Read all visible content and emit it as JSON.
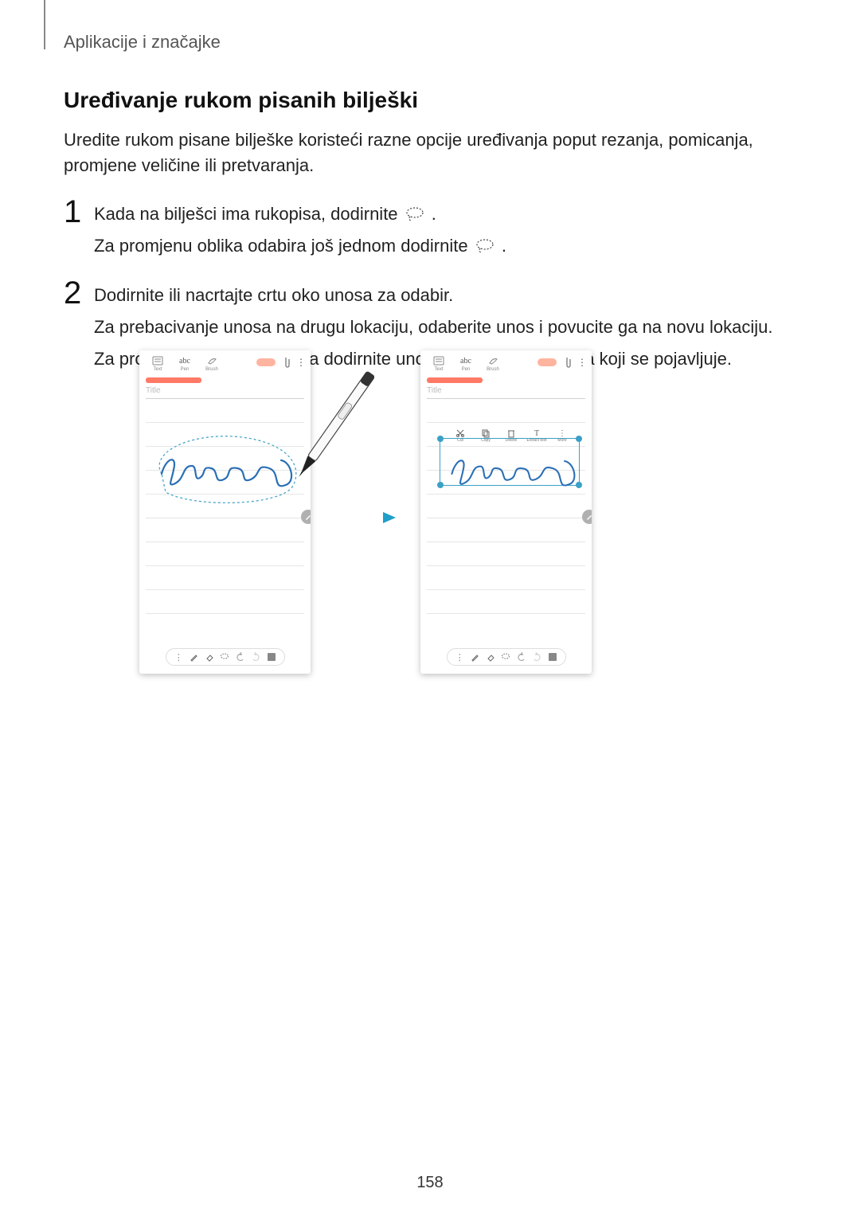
{
  "breadcrumb": "Aplikacije i značajke",
  "section_title": "Uređivanje rukom pisanih bilješki",
  "intro": "Uredite rukom pisane bilješke koristeći razne opcije uređivanja poput rezanja, pomicanja, promjene veličine ili pretvaranja.",
  "steps": {
    "1": {
      "num": "1",
      "line1_a": "Kada na bilješci ima rukopisa, dodirnite ",
      "line1_b": ".",
      "line2_a": "Za promjenu oblika odabira još jednom dodirnite ",
      "line2_b": "."
    },
    "2": {
      "num": "2",
      "line1": "Dodirnite ili nacrtajte crtu oko unosa za odabir.",
      "line2": "Za prebacivanje unosa na drugu lokaciju, odaberite unos i povucite ga na novu lokaciju.",
      "line3": "Za promjenu veličine odabira dodirnite unos i povucite rub okvira koji se pojavljuje."
    }
  },
  "screen": {
    "tabs": {
      "text": "Text",
      "pen": "Pen",
      "brush": "Brush",
      "abc": "abc"
    },
    "title_placeholder": "Title",
    "handwriting_text": "Samsung",
    "sel_toolbar": {
      "cut": "Cut",
      "copy": "Copy",
      "delete": "Delete",
      "extract": "Extract text",
      "more": "More"
    }
  },
  "page_number": "158"
}
